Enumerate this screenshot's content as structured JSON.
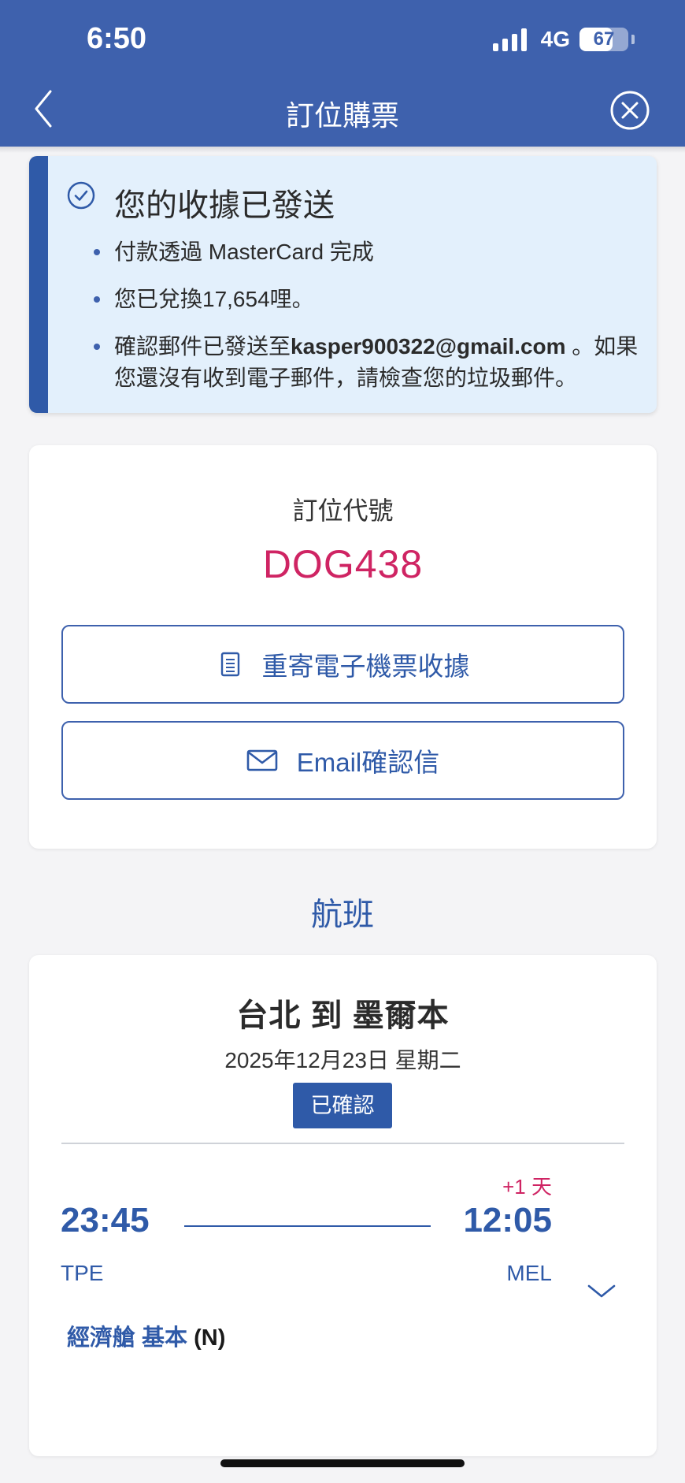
{
  "status_bar": {
    "time": "6:50",
    "network": "4G",
    "battery": "67",
    "battery_level": 0.67
  },
  "header": {
    "title": "訂位購票"
  },
  "notice": {
    "title": "您的收據已發送",
    "items": [
      {
        "text": "付款透過 MasterCard 完成"
      },
      {
        "text": "您已兌換17,654哩。"
      },
      {
        "prefix": "確認郵件已發送至",
        "email": "kasper900322@gmail.com",
        "suffix": " 。如果您還沒有收到電子郵件，請檢查您的垃圾郵件。"
      }
    ]
  },
  "booking": {
    "label": "訂位代號",
    "code": "DOG438",
    "resend_button": "重寄電子機票收據",
    "email_button": "Email確認信"
  },
  "flights_section": {
    "title": "航班"
  },
  "flight": {
    "route": "台北 到 墨爾本",
    "date": "2025年12月23日 星期二",
    "status": "已確認",
    "plus_day": "+1 天",
    "departure_time": "23:45",
    "arrival_time": "12:05",
    "departure_code": "TPE",
    "arrival_code": "MEL",
    "cabin": "經濟艙 基本",
    "class_code": "(N)"
  },
  "colors": {
    "header": "#3e61ad",
    "accent": "#2f5aa8",
    "highlight": "#cf2463",
    "notice_bg": "#e3f0fc"
  },
  "icons": [
    "chevron-left-icon",
    "close-circle-icon",
    "check-circle-icon",
    "document-icon",
    "envelope-icon",
    "chevron-down-icon"
  ]
}
